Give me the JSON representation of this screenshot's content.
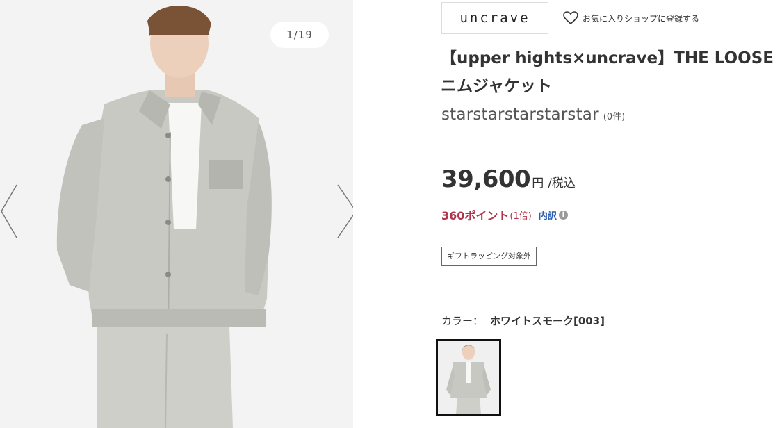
{
  "gallery": {
    "counter": "1/19",
    "prev_icon": "chevron-left-icon",
    "next_icon": "chevron-right-icon"
  },
  "shop": {
    "brand_logo_text": "uncrave",
    "favorite_label": "お気に入りショップに登録する",
    "favorite_icon": "heart-icon"
  },
  "product": {
    "title": "【upper hights×uncrave】THE LOOSE\nニムジャケット",
    "stars_text": "starstarstarstarstar",
    "review_count": "(0件)",
    "price_value": "39,600",
    "price_yen": "円",
    "price_tax": "/税込",
    "points_value": "360ポイント",
    "points_rate": "(1倍)",
    "breakdown_label": "内訳",
    "gift_tag": "ギフトラッピング対象外",
    "color_label": "カラー：",
    "color_name": "ホワイトスモーク[003]"
  },
  "colors": {
    "points": "#b0344a",
    "link": "#2a5db0",
    "text": "#333333",
    "swatch_border": "#111111"
  }
}
